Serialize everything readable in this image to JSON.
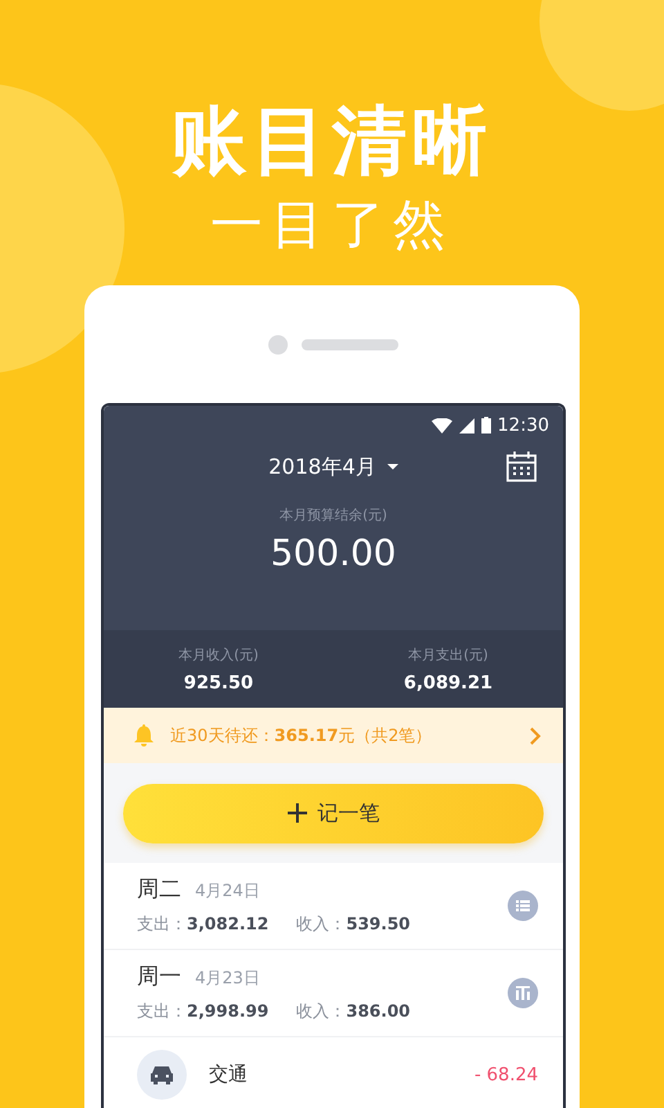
{
  "headline": "账目清晰",
  "subheadline": "一目了然",
  "status_bar": {
    "time": "12:30"
  },
  "header": {
    "month": "2018年4月",
    "budget_label": "本月预算结余(元)",
    "budget": "500.00"
  },
  "summary": [
    {
      "label": "本月收入(元)",
      "value": "925.50"
    },
    {
      "label": "本月支出(元)",
      "value": "6,089.21"
    }
  ],
  "reminder": {
    "text": "近30天待还：**365.17**元（共2笔）"
  },
  "add_button": {
    "label": "记一笔"
  },
  "days": [
    {
      "weekday": "周二",
      "date": "4月24日",
      "expense": "支出：**3,082.12**",
      "income": "收入：**539.50**",
      "kind": "list"
    },
    {
      "weekday": "周一",
      "date": "4月23日",
      "expense": "支出：**2,998.99**",
      "income": "收入：**386.00**",
      "kind": "chart"
    }
  ],
  "transactions": [
    {
      "category": "交通",
      "amount": "- 68.24",
      "kind": "car"
    }
  ]
}
